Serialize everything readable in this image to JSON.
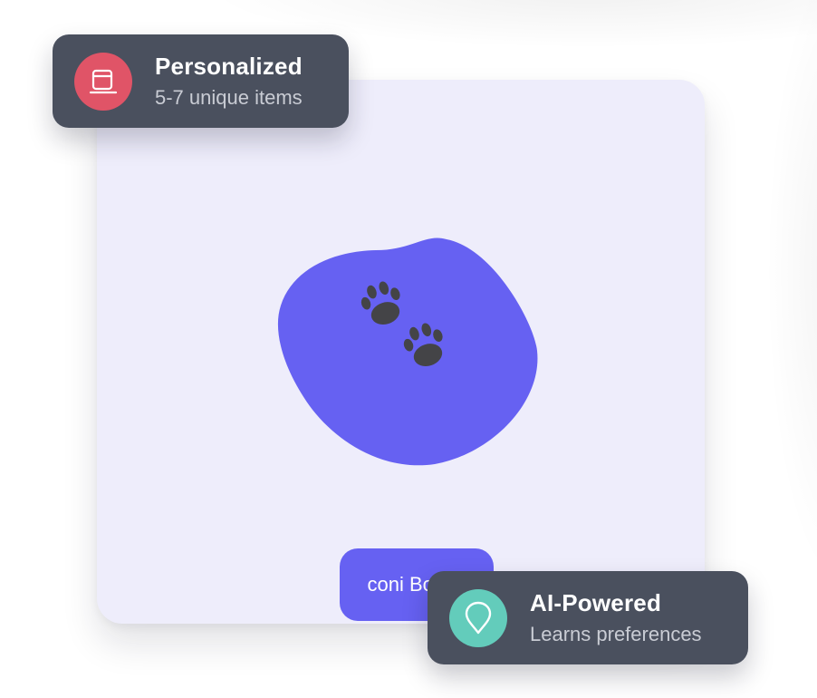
{
  "product": {
    "cta_label": "coni Box ✦"
  },
  "features": {
    "personalized": {
      "title": "Personalized",
      "subtitle": "5-7 unique items",
      "icon": "box-icon",
      "color": "#e05467"
    },
    "ai": {
      "title": "AI-Powered",
      "subtitle": "Learns preferences",
      "icon": "location-pin-icon",
      "color": "#63ccbb"
    }
  },
  "colors": {
    "card_background": "#eeedfb",
    "accent": "#6661f2",
    "badge_background": "#4a505e"
  }
}
